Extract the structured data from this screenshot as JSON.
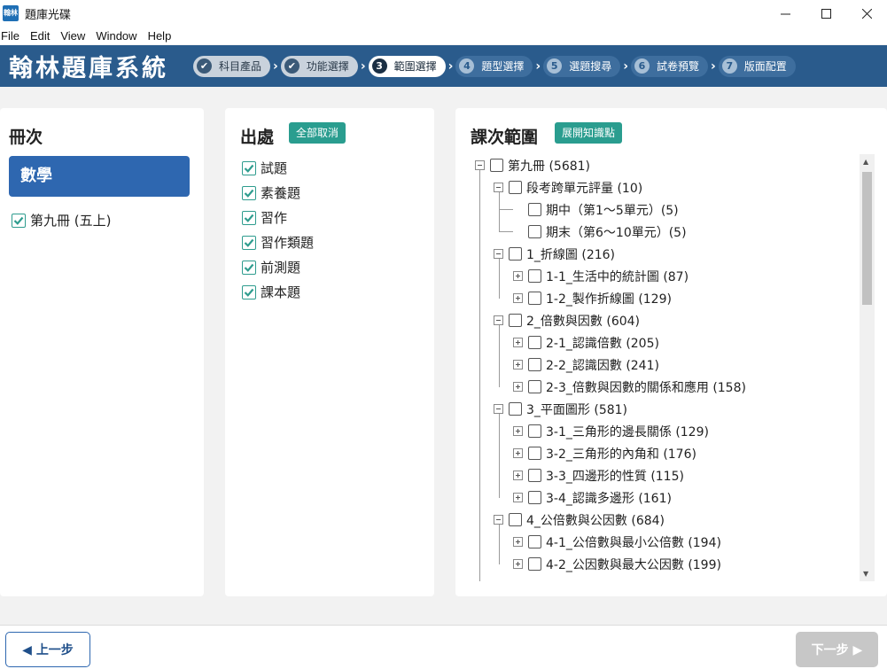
{
  "window": {
    "title": "題庫光碟",
    "app_icon_text": "翰林"
  },
  "menu": [
    "File",
    "Edit",
    "View",
    "Window",
    "Help"
  ],
  "header": {
    "brand": "翰林題庫系統",
    "steps": [
      {
        "num": "✔",
        "label": "科目產品",
        "state": "done"
      },
      {
        "num": "✔",
        "label": "功能選擇",
        "state": "done"
      },
      {
        "num": "3",
        "label": "範圍選擇",
        "state": "active"
      },
      {
        "num": "4",
        "label": "題型選擇",
        "state": "todo"
      },
      {
        "num": "5",
        "label": "選題搜尋",
        "state": "todo"
      },
      {
        "num": "6",
        "label": "試卷預覽",
        "state": "todo"
      },
      {
        "num": "7",
        "label": "版面配置",
        "state": "todo"
      }
    ]
  },
  "volume_panel": {
    "title": "冊次",
    "subject": "數學",
    "volume_label": "第九冊 (五上)"
  },
  "source_panel": {
    "title": "出處",
    "deselect_all": "全部取消",
    "items": [
      "試題",
      "素養題",
      "習作",
      "習作類題",
      "前測題",
      "課本題"
    ]
  },
  "range_panel": {
    "title": "課次範圍",
    "expand_btn": "展開知識點",
    "tree": [
      {
        "level": 0,
        "exp": "minus",
        "label": "第九冊 (5681)"
      },
      {
        "level": 1,
        "exp": "minus",
        "label": "段考跨單元評量 (10)"
      },
      {
        "level": 2,
        "exp": "none",
        "label": "期中（第1～5單元）(5)"
      },
      {
        "level": 2,
        "exp": "none",
        "label": "期末（第6～10單元）(5)"
      },
      {
        "level": 1,
        "exp": "minus",
        "label": "1_折線圖 (216)"
      },
      {
        "level": 2,
        "exp": "plus",
        "label": "1-1_生活中的統計圖 (87)"
      },
      {
        "level": 2,
        "exp": "plus",
        "label": "1-2_製作折線圖 (129)"
      },
      {
        "level": 1,
        "exp": "minus",
        "label": "2_倍數與因數 (604)"
      },
      {
        "level": 2,
        "exp": "plus",
        "label": "2-1_認識倍數 (205)"
      },
      {
        "level": 2,
        "exp": "plus",
        "label": "2-2_認識因數 (241)"
      },
      {
        "level": 2,
        "exp": "plus",
        "label": "2-3_倍數與因數的關係和應用 (158)"
      },
      {
        "level": 1,
        "exp": "minus",
        "label": "3_平面圖形 (581)"
      },
      {
        "level": 2,
        "exp": "plus",
        "label": "3-1_三角形的邊長關係 (129)"
      },
      {
        "level": 2,
        "exp": "plus",
        "label": "3-2_三角形的內角和 (176)"
      },
      {
        "level": 2,
        "exp": "plus",
        "label": "3-3_四邊形的性質 (115)"
      },
      {
        "level": 2,
        "exp": "plus",
        "label": "3-4_認識多邊形 (161)"
      },
      {
        "level": 1,
        "exp": "minus",
        "label": "4_公倍數與公因數 (684)"
      },
      {
        "level": 2,
        "exp": "plus",
        "label": "4-1_公倍數與最小公倍數 (194)"
      },
      {
        "level": 2,
        "exp": "plus",
        "label": "4-2_公因數與最大公因數 (199)"
      }
    ]
  },
  "footer": {
    "prev": "◀ 上一步",
    "next": "下一步 ▶"
  },
  "colors": {
    "header_bg": "#2a5b8c",
    "subject_bg": "#2e67b0",
    "accent_teal": "#2a9d8f",
    "check_green": "#2e9c8e"
  }
}
